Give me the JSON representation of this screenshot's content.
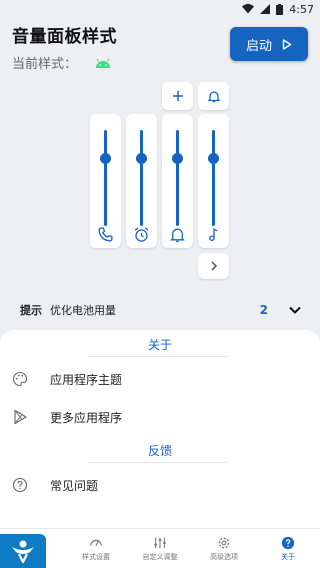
{
  "status_bar": {
    "time": "4:57"
  },
  "header": {
    "title": "音量面板样式",
    "subtitle": "当前样式："
  },
  "start_button": {
    "label": "启动"
  },
  "sliders": [
    {
      "icon": "phone-icon",
      "level": 0.3
    },
    {
      "icon": "alarm-icon",
      "level": 0.3
    },
    {
      "icon": "bell-icon",
      "level": 0.3
    },
    {
      "icon": "music-note-icon",
      "level": 0.3
    }
  ],
  "tip": {
    "label": "提示",
    "text": "优化电池用量",
    "count": "2"
  },
  "sheet": {
    "about_header": "关于",
    "items_about": [
      {
        "icon": "palette-icon",
        "label": "应用程序主题"
      },
      {
        "icon": "play-store-icon",
        "label": "更多应用程序"
      }
    ],
    "feedback_header": "反馈",
    "items_feedback": [
      {
        "icon": "help-circle-icon",
        "label": "常见问题"
      }
    ]
  },
  "bottom_nav": [
    {
      "icon": "palette-icon",
      "label": "样式"
    },
    {
      "icon": "gauge-icon",
      "label": "样式设置"
    },
    {
      "icon": "sliders-icon",
      "label": "自定义调整"
    },
    {
      "icon": "gear-icon",
      "label": "高级选项"
    },
    {
      "icon": "help-icon",
      "label": "关于"
    }
  ],
  "colors": {
    "accent": "#1565c0",
    "background": "#eeeff2",
    "card": "#ffffff",
    "android_green": "#3ddc84"
  }
}
